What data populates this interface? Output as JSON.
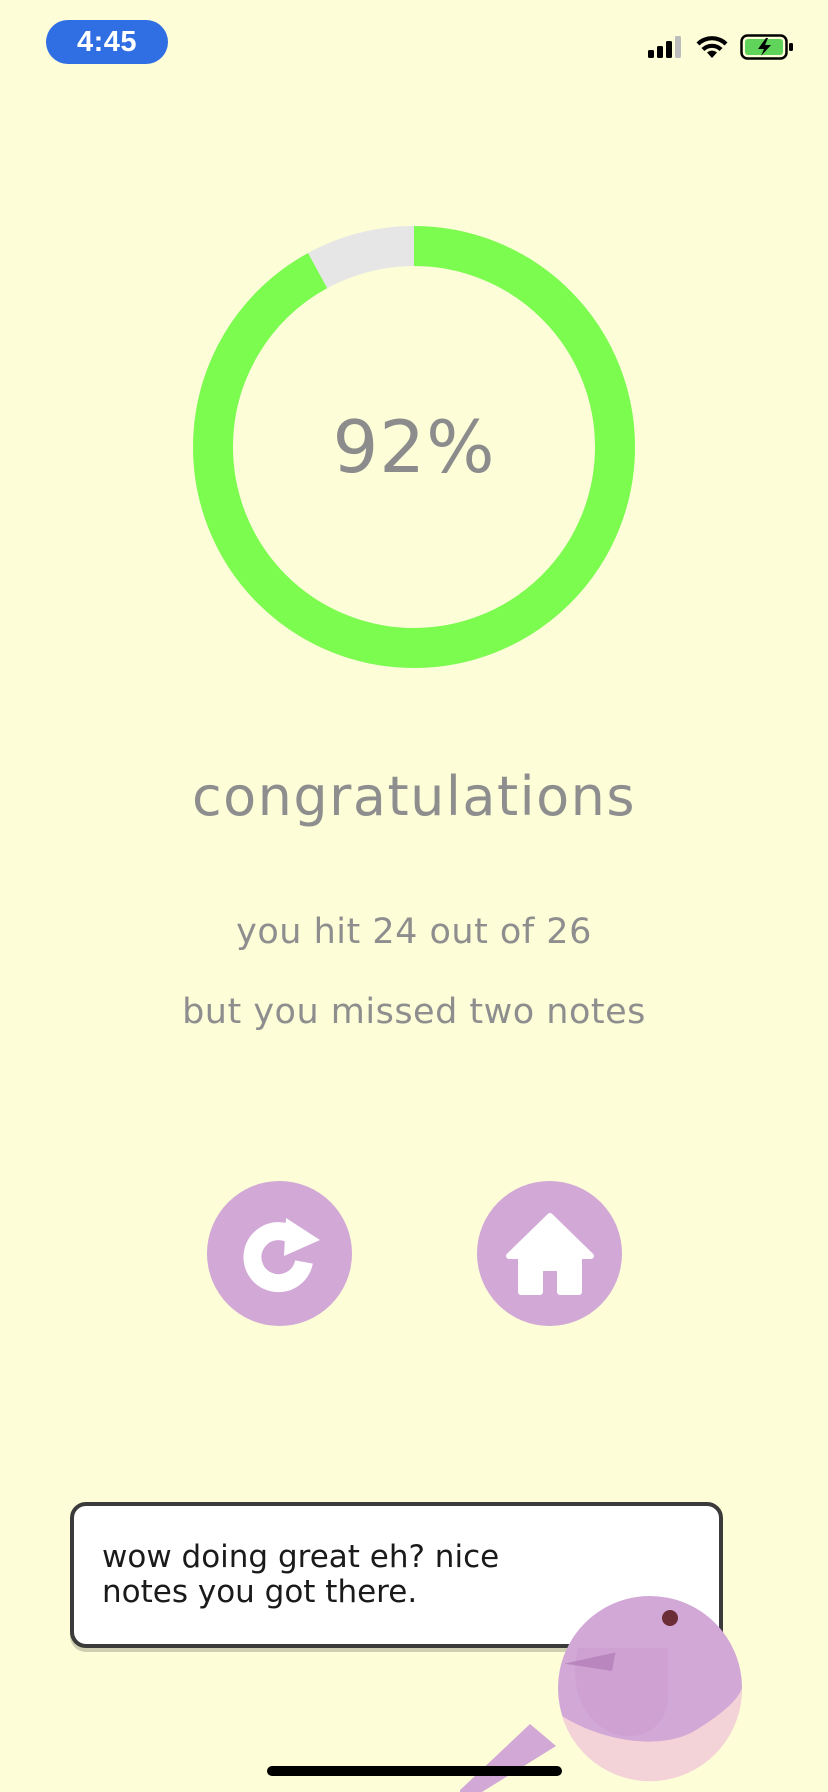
{
  "status_bar": {
    "time": "4:45",
    "icons": [
      "cellular-signal-icon",
      "wifi-icon",
      "battery-charging-icon"
    ]
  },
  "result": {
    "percent": 92,
    "percent_label": "92%",
    "headline": "congratulations",
    "hit_line": "you hit 24 out of 26",
    "miss_line": "but you missed two notes"
  },
  "actions": {
    "retry_icon": "retry-icon",
    "home_icon": "home-icon"
  },
  "mascot": {
    "speech": "wow doing great eh? nice notes you got there."
  },
  "colors": {
    "background": "#fdfdd8",
    "progress": "#7cfc4f",
    "progress_track": "#e6e6e6",
    "button": "#d1a8d6",
    "time_pill": "#2f6ee3"
  }
}
